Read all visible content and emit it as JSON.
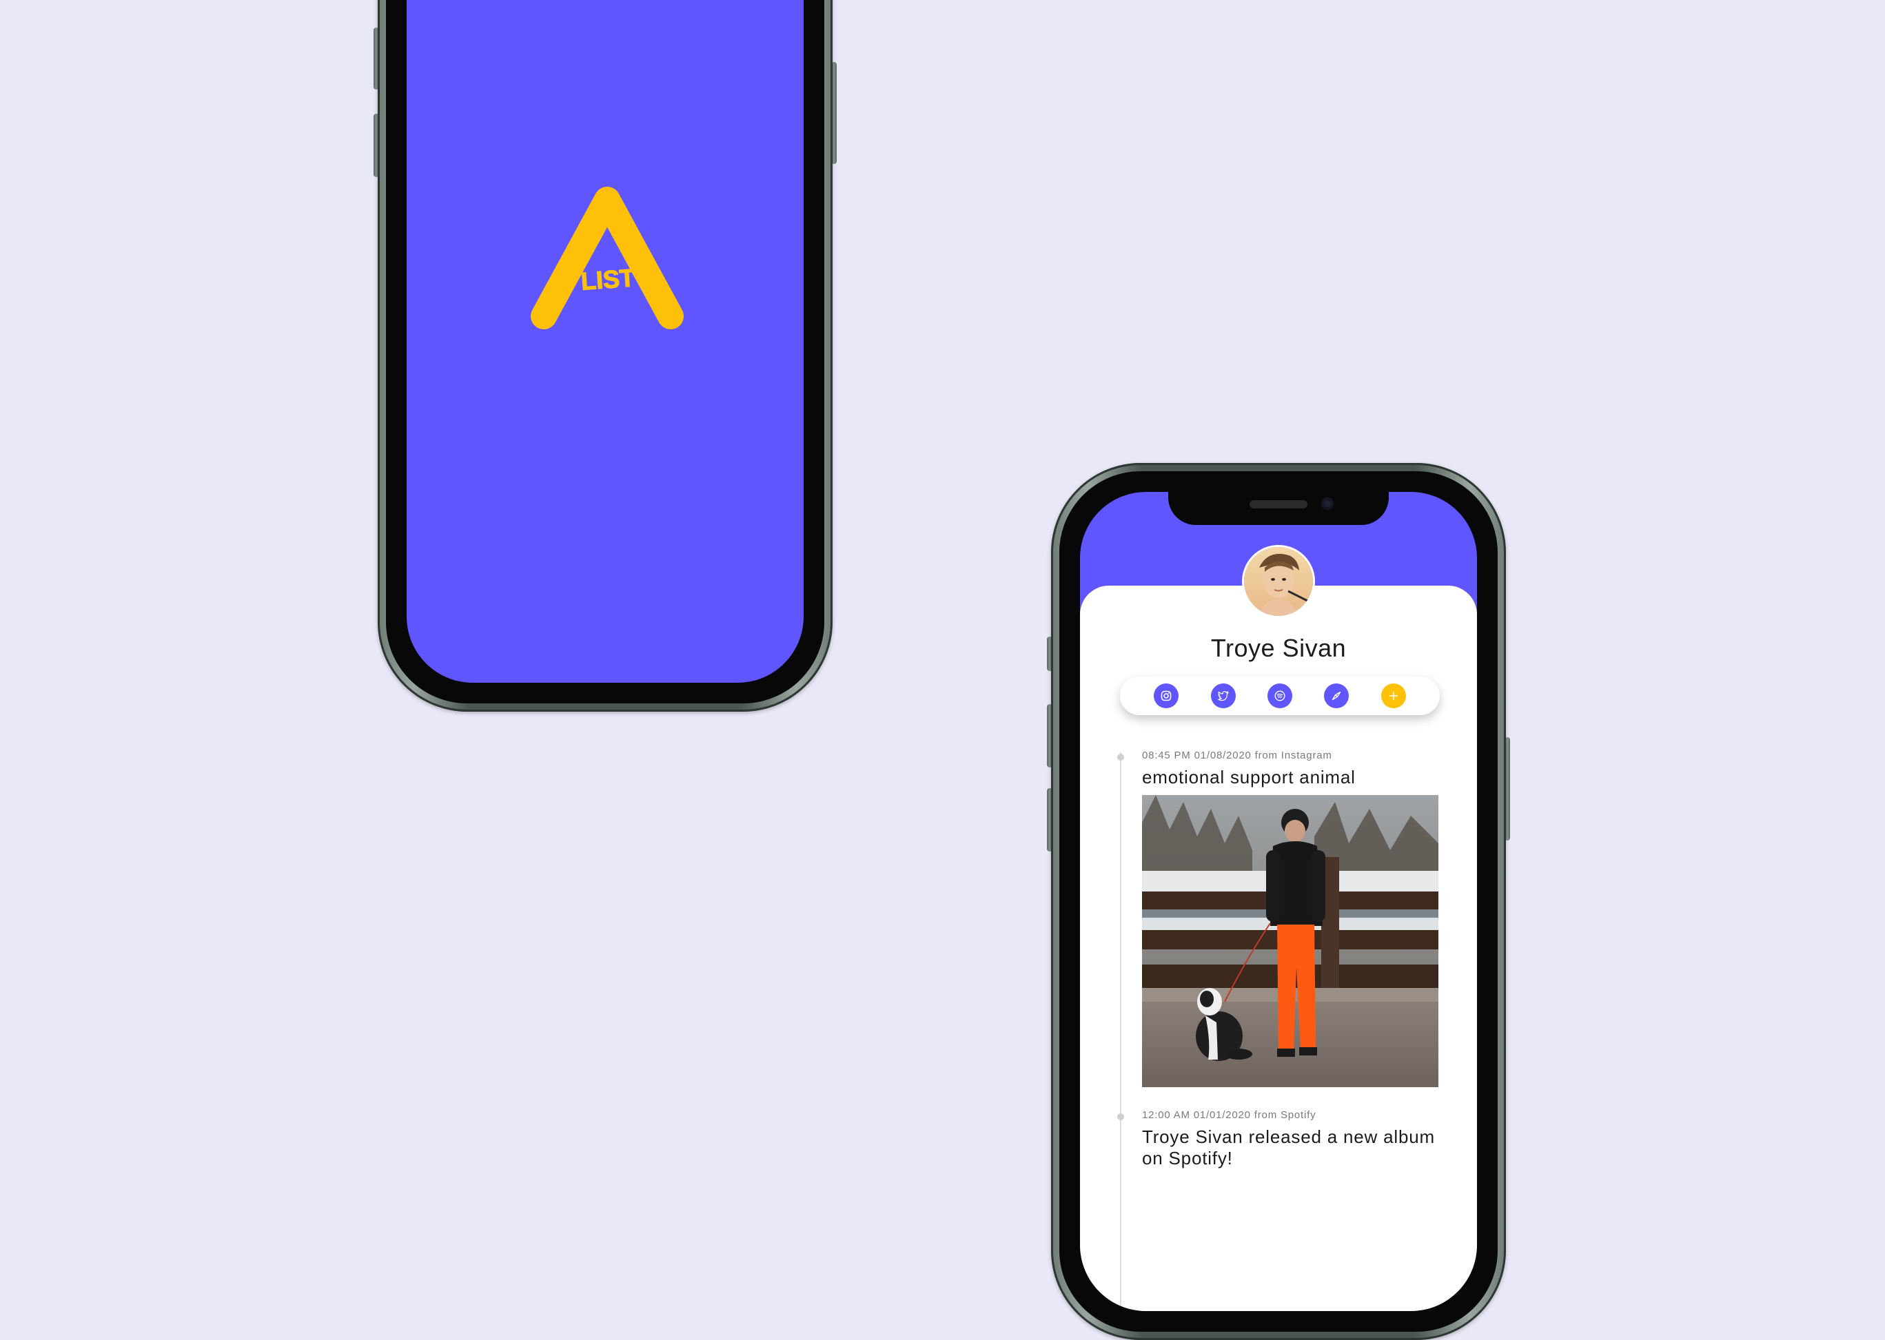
{
  "splash": {
    "logo_text": "LIST",
    "background_color": "#6056ff",
    "logo_color": "#ffc107"
  },
  "profile": {
    "name": "Troye Sivan"
  },
  "social_bar": {
    "items": [
      {
        "icon": "instagram-icon"
      },
      {
        "icon": "twitter-icon"
      },
      {
        "icon": "spotify-icon"
      },
      {
        "icon": "compass-icon"
      },
      {
        "icon": "add-icon"
      }
    ]
  },
  "feed": {
    "posts": [
      {
        "meta": "08:45 PM 01/08/2020 from Instagram",
        "text": "emotional support animal"
      },
      {
        "meta": "12:00 AM 01/01/2020 from Spotify",
        "text": "Troye Sivan released a new album on Spotify!"
      }
    ]
  }
}
